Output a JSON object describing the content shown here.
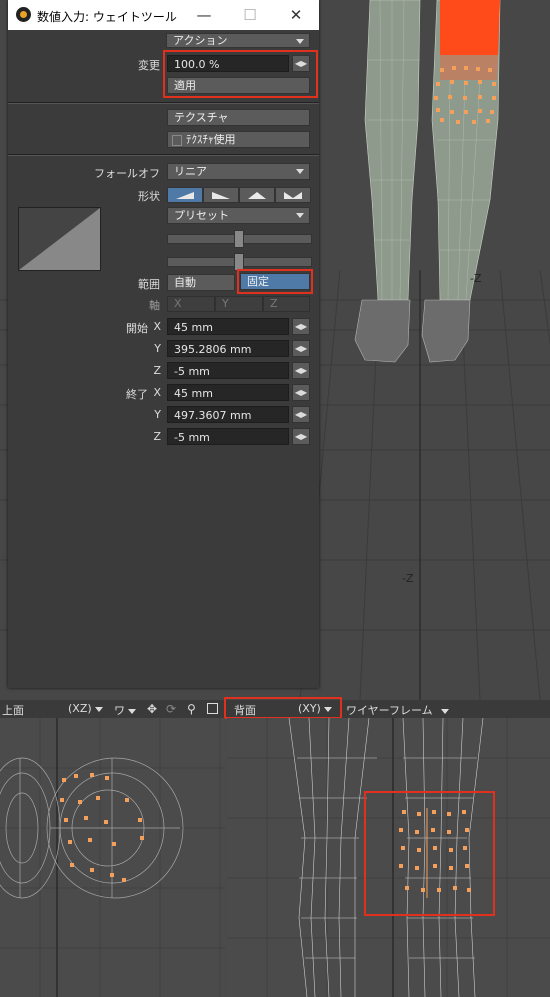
{
  "window": {
    "title": "数値入力: ウェイトツール",
    "minimize": "—",
    "maximize": "☐",
    "close": "✕"
  },
  "action": {
    "value": "アクション"
  },
  "change": {
    "label": "変更",
    "value": "100.0 %",
    "apply_label": "適用"
  },
  "texture": {
    "texture_label": "テクスチャ",
    "use_texture_label": "ﾃｸｽﾁｬ使用"
  },
  "falloff": {
    "label": "フォールオフ",
    "value": "リニア"
  },
  "shape": {
    "label": "形状",
    "preset_label": "プリセット"
  },
  "range": {
    "label": "範囲",
    "auto_label": "自動",
    "fixed_label": "固定"
  },
  "axis": {
    "label": "軸",
    "x": "X",
    "y": "Y",
    "z": "Z"
  },
  "start": {
    "label": "開始",
    "x_label": "X",
    "y_label": "Y",
    "z_label": "Z",
    "x": "45 mm",
    "y": "395.2806 mm",
    "z": "-5 mm"
  },
  "end": {
    "label": "終了",
    "x_label": "X",
    "y_label": "Y",
    "z_label": "Z",
    "x": "45 mm",
    "y": "497.3607 mm",
    "z": "-5 mm"
  },
  "viewports": {
    "top_view": {
      "name": "上面",
      "axes": "(XZ)"
    },
    "wire_short": "ワ",
    "back_view": {
      "name": "背面",
      "axes": "(XY)"
    },
    "wireframe": "ワイヤーフレーム",
    "top_axis_z1": "-Z",
    "top_axis_z2": "-Z"
  },
  "colors": {
    "accent_red": "#e0301e",
    "selection_orange": "#f4a05a",
    "fixed_blue": "#4f7aa8",
    "highlight_orange": "#ff4a1a"
  }
}
